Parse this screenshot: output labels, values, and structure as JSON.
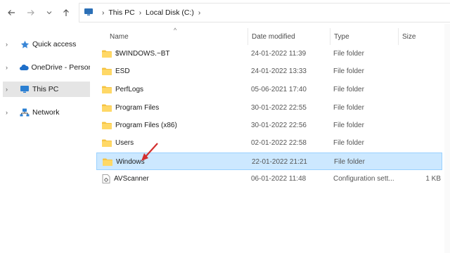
{
  "address": {
    "crumbs": [
      "This PC",
      "Local Disk (C:)"
    ]
  },
  "sidebar": {
    "items": [
      {
        "label": "Quick access",
        "icon": "star-icon"
      },
      {
        "label": "OneDrive - Personal",
        "icon": "cloud-icon"
      },
      {
        "label": "This PC",
        "icon": "monitor-icon",
        "selected": true
      },
      {
        "label": "Network",
        "icon": "network-icon"
      }
    ]
  },
  "columns": {
    "name": "Name",
    "date": "Date modified",
    "type": "Type",
    "size": "Size"
  },
  "files": [
    {
      "name": "$WINDOWS.~BT",
      "date": "24-01-2022 11:39",
      "type": "File folder",
      "size": ""
    },
    {
      "name": "ESD",
      "date": "24-01-2022 13:33",
      "type": "File folder",
      "size": ""
    },
    {
      "name": "PerfLogs",
      "date": "05-06-2021 17:40",
      "type": "File folder",
      "size": ""
    },
    {
      "name": "Program Files",
      "date": "30-01-2022 22:55",
      "type": "File folder",
      "size": ""
    },
    {
      "name": "Program Files (x86)",
      "date": "30-01-2022 22:56",
      "type": "File folder",
      "size": ""
    },
    {
      "name": "Users",
      "date": "02-01-2022 22:58",
      "type": "File folder",
      "size": ""
    },
    {
      "name": "Windows",
      "date": "22-01-2022 21:21",
      "type": "File folder",
      "size": "",
      "selected": true
    },
    {
      "name": "AVScanner",
      "date": "06-01-2022 11:48",
      "type": "Configuration sett...",
      "size": "1 KB"
    }
  ],
  "colors": {
    "selection_bg": "#cce8ff",
    "selection_border": "#99d1ff",
    "folder": "#f5c342",
    "annotation_arrow": "#d32f2f"
  }
}
